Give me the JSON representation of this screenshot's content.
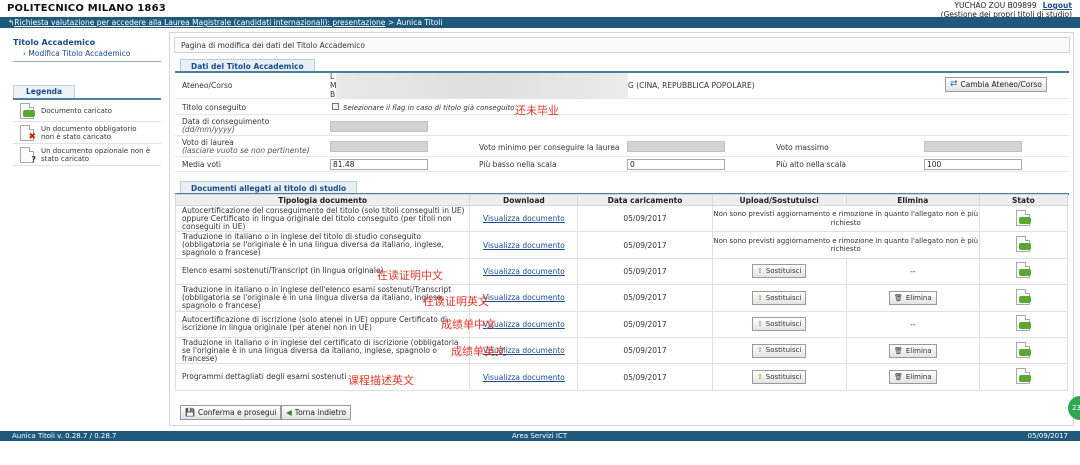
{
  "header": {
    "brand": "POLITECNICO MILANO 1863",
    "user_name": "YUCHAO ZOU B09899",
    "logout": "Logout",
    "user_sub": "(Gestione dei propri titoli di studio)",
    "breadcrumb_link": "Richiesta valutazione per accedere alla Laurea Magistrale (candidati internazionali): presentazione",
    "breadcrumb_sep": ">",
    "breadcrumb_current": "Aunica Titoli"
  },
  "sidebar": {
    "title": "Titolo Accademico",
    "link": "Modifica Titolo Accademico"
  },
  "legend": {
    "title": "Legenda",
    "items": [
      {
        "label": "Documento caricato",
        "icon": "document-uploaded-icon"
      },
      {
        "label": "Un documento obbligatorio non è stato caricato",
        "icon": "document-missing-required-icon"
      },
      {
        "label": "Un documento opzionale non è stato caricato",
        "icon": "document-missing-optional-icon"
      }
    ]
  },
  "page_heading": "Pagina di modifica dei dati del Titolo Accademico",
  "section1": {
    "tab": "Dati del Titolo Accademico",
    "ateneo_label": "Ateneo/Corso",
    "ateneo_line1": "L",
    "ateneo_line2": "M",
    "ateneo_line3": "B",
    "ateneo_country": "G (CINA, REPUBBLICA POPOLARE)",
    "change_button": "Cambia Ateneo/Corso",
    "titolo_label": "Titolo conseguito",
    "titolo_flag": "Selezionare il flag in caso di titolo già conseguito",
    "data_label": "Data di conseguimento",
    "data_hint": "(dd/mm/yyyy)",
    "voto_label": "Voto di laurea",
    "voto_hint": "(lasciare vuoto se non pertinente)",
    "voto_min_label": "Voto minimo per conseguire la laurea",
    "voto_max_label": "Voto massimo",
    "media_label": "Media voti",
    "media_value": "81.48",
    "piu_basso_label": "Più basso nella scala",
    "piu_basso_value": "0",
    "piu_alto_label": "Più alto nella scala",
    "piu_alto_value": "100"
  },
  "section2": {
    "tab": "Documenti allegati al titolo di studio",
    "columns": [
      "Tipologia documento",
      "Download",
      "Data caricamento",
      "Upload/Sostutuisci",
      "Elimina",
      "Stato"
    ],
    "rows": [
      {
        "type": "Autocertificazione del conseguimento del titolo (solo titoli conseguiti in UE) oppure Certificato in lingua originale del titolo conseguito (per titoli non conseguiti in UE)",
        "download": "Visualizza documento",
        "date": "05/09/2017",
        "upload": "Non sono previsti aggiornamento e rimozione in quanto l'allegato non è più richiesto",
        "elimina": ""
      },
      {
        "type": "Traduzione in italiano o in inglese del titolo di studio conseguito (obbligatoria se l'originale è in una lingua diversa da italiano, inglese, spagnolo o francese)",
        "download": "Visualizza documento",
        "date": "05/09/2017",
        "upload": "Non sono previsti aggiornamento e rimozione in quanto l'allegato non è più richiesto",
        "elimina": ""
      },
      {
        "type": "Elenco esami sostenuti/Transcript (in lingua originale)",
        "download": "Visualizza documento",
        "date": "05/09/2017",
        "upload": "Sostituisci",
        "elimina": "--"
      },
      {
        "type": "Traduzione in italiano o in inglese dell'elenco esami sostenuti/Transcript (obbligatoria se l'originale è in una lingua diversa da italiano, inglese, spagnolo o francese)",
        "download": "Visualizza documento",
        "date": "05/09/2017",
        "upload": "Sostituisci",
        "elimina": "Elimina"
      },
      {
        "type": "Autocertificazione di iscrizione (solo atenei in UE) oppure Certificato di iscrizione in lingua originale (per atenei non in UE)",
        "download": "Visualizza documento",
        "date": "05/09/2017",
        "upload": "Sostituisci",
        "elimina": "--"
      },
      {
        "type": "Traduzione in italiano o in inglese del certificato di iscrizione (obbligatoria se l'originale è in una lingua diversa da italiano, inglese, spagnolo o francese)",
        "download": "Visualizza documento",
        "date": "05/09/2017",
        "upload": "Sostituisci",
        "elimina": "Elimina"
      },
      {
        "type": "Programmi dettagliati degli esami sostenuti",
        "download": "Visualizza documento",
        "date": "05/09/2017",
        "upload": "Sostituisci",
        "elimina": "Elimina"
      }
    ]
  },
  "annotations": {
    "not_graduated": "还未毕业",
    "enrollment_cn": "在读证明中文",
    "enrollment_en": "在读证明英文",
    "transcript_cn": "成绩单中文",
    "transcript_en": "成绩单英文",
    "course_desc_en": "课程描述英文"
  },
  "actions": {
    "confirm": "Conferma e prosegui",
    "back": "Torna indietro"
  },
  "footer": {
    "version": "Aunica Titoli v. 0.28.7 / 0.28.7",
    "area": "Area Servizi ICT",
    "date": "05/09/2017"
  },
  "corner_badge": "23",
  "colors": {
    "nav_blue": "#1f5a7d",
    "link_blue": "#1a4c8a",
    "annotation_red": "#e0392b",
    "status_green": "#5aa832"
  }
}
